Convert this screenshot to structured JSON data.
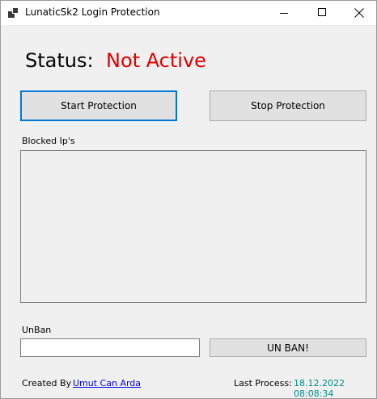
{
  "window": {
    "title": "LunaticSk2 Login Protection",
    "icon": "app-window-icon"
  },
  "status": {
    "label": "Status:",
    "value": "Not Active",
    "value_color": "#e00000"
  },
  "buttons": {
    "start": "Start Protection",
    "stop": "Stop Protection",
    "unban": "UN BAN!"
  },
  "blocked": {
    "label": "Blocked Ip's",
    "items": []
  },
  "unban": {
    "label": "UnBan",
    "value": ""
  },
  "footer": {
    "created_label": "Created By",
    "author": "Umut Can Arda",
    "last_process_label": "Last Process:",
    "last_process_time": "18.12.2022 08:08:34"
  }
}
